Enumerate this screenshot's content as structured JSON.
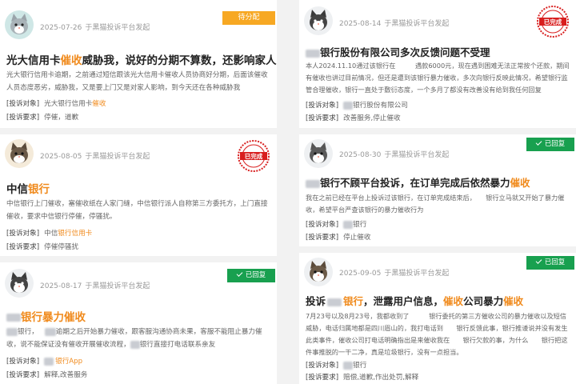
{
  "platform_text": "于黑猫投诉平台发起",
  "labels": {
    "target": "[投诉对象]",
    "request": "[投诉要求]"
  },
  "badges": {
    "pending": "待分配",
    "replied": "已回复",
    "completed": "已完成"
  },
  "colors": {
    "highlight": "#f08a1c",
    "pending": "#f7a823",
    "replied": "#18a04f",
    "stamp": "#d81e1e"
  },
  "left": [
    {
      "date": "2025-07-26",
      "status": "pending",
      "title": [
        "光大信用卡",
        "催收",
        "威胁我，说好的分期不算数，还影响家人！"
      ],
      "desc": "光大银行信用卡逾期，之前通过短信跟该光大信用卡催收人员协商好分期，后面该催收人员态度恶劣，威胁我，又是要上门又是对家人影响，到今天还在各种威胁我",
      "target": [
        "光大银行信用卡",
        "催收"
      ],
      "request": "停催，道歉"
    },
    {
      "date": "2025-08-05",
      "status": "completed",
      "title": [
        "中信",
        "银行",
        ""
      ],
      "desc": "中信银行上门催收，塞催收纸在人家门缝，中信银行派人自称第三方委托方，上门直接催收，要求中信银行停催，停骚扰。",
      "target": [
        "中信",
        "银行信用卡"
      ],
      "request": "停催停骚扰"
    },
    {
      "date": "2025-08-17",
      "status": "replied",
      "title": [
        "银行暴力",
        "催收",
        ""
      ],
      "desc1": "银行，",
      "desc2": "逾期之后开始暴力催收，跟客服沟通协商未果，客服不能阻止暴力催收，说不能保证没有催收开展催收流程，",
      "desc3": "银行直接打电话联系亲友",
      "target": [
        "",
        "银行App"
      ],
      "request": "解释,改善服务"
    }
  ],
  "right": [
    {
      "date": "2025-08-14",
      "status": "completed",
      "title": "银行股份有限公司多次反馈问题不受理",
      "desc": "本人2024.11.10通过该银行在　　　遇款6000元，现在遇到困难无法正常按个还款，期间有催收也讲过目前情况，但还是遭到该银行暴力催收，多次向银行反映此情况，希望银行监管合理催收，银行一直处于敷衍态度，一个多月了都没有改善没有给到我任何回复",
      "target": "银行股份有限公司",
      "request": "改善服务,停止催收"
    },
    {
      "date": "2025-08-30",
      "status": "replied",
      "title": [
        "银行不顾平台投诉，在订单完成后依然暴力",
        "催收"
      ],
      "desc": "我在之前已经在平台上投诉过该银行，在订单完成结束后，　　银行立马就又开始了暴力催收，希望平台严查该银行的暴力催收行为",
      "target": "银行",
      "request": "停止催收"
    },
    {
      "date": "2025-09-05",
      "status": "replied",
      "title": [
        "投诉",
        "银行",
        "，泄露用户信息，",
        "催收",
        "公司暴力",
        "催收"
      ],
      "desc": "7月23号以及8月23号，我都收到了　　　银行委托的第三方催收公司的暴力催收以及短信威胁，电话归属地都是四川眉山的，我打电话到　　银行反馈此事，银行推诿说并没有发生此类事件，催收公司打电话明确指出是来催收我在　　银行欠款的事，为什么　　银行把这件事推脱的一干二净，真是垃圾银行，没有一点担当。",
      "target": "银行",
      "request": "赔偿,道歉,作出处罚,解释"
    }
  ]
}
